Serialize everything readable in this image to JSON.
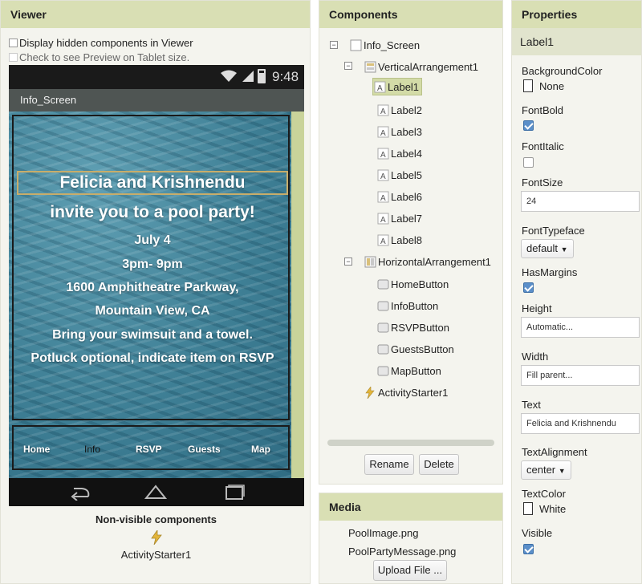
{
  "viewer": {
    "title": "Viewer",
    "display_hidden_label": "Display hidden components in Viewer",
    "tablet_preview_label": "Check to see Preview on Tablet size.",
    "status_time": "9:48",
    "screen_title": "Info_Screen",
    "message_lines": [
      "Felicia and Krishnendu",
      "invite you to a pool party!",
      "July 4",
      "3pm- 9pm",
      "1600 Amphitheatre Parkway,",
      "Mountain View, CA",
      "Bring your swimsuit and a towel.",
      "Potluck optional, indicate item on RSVP"
    ],
    "nav_buttons": [
      "Home",
      "Info",
      "RSVP",
      "Guests",
      "Map"
    ],
    "nonvisible_title": "Non-visible components",
    "nonvisible_item": "ActivityStarter1"
  },
  "components": {
    "title": "Components",
    "root": "Info_Screen",
    "vertical": "VerticalArrangement1",
    "labels": [
      "Label1",
      "Label2",
      "Label3",
      "Label4",
      "Label5",
      "Label6",
      "Label7",
      "Label8"
    ],
    "horizontal": "HorizontalArrangement1",
    "buttons": [
      "HomeButton",
      "InfoButton",
      "RSVPButton",
      "GuestsButton",
      "MapButton"
    ],
    "activity": "ActivityStarter1",
    "rename_label": "Rename",
    "delete_label": "Delete"
  },
  "media": {
    "title": "Media",
    "files": [
      "PoolImage.png",
      "PoolPartyMessage.png"
    ],
    "upload_label": "Upload File ..."
  },
  "properties": {
    "title": "Properties",
    "selected": "Label1",
    "background_color_label": "BackgroundColor",
    "background_color_value": "None",
    "fontbold_label": "FontBold",
    "fontbold_checked": true,
    "fontitalic_label": "FontItalic",
    "fontitalic_checked": false,
    "fontsize_label": "FontSize",
    "fontsize_value": "24",
    "fonttypeface_label": "FontTypeface",
    "fonttypeface_value": "default",
    "hasmargins_label": "HasMargins",
    "hasmargins_checked": true,
    "height_label": "Height",
    "height_value": "Automatic...",
    "width_label": "Width",
    "width_value": "Fill parent...",
    "text_label": "Text",
    "text_value": "Felicia and Krishnendu",
    "textalignment_label": "TextAlignment",
    "textalignment_value": "center",
    "textcolor_label": "TextColor",
    "textcolor_value": "White",
    "visible_label": "Visible",
    "visible_checked": true
  },
  "colors": {
    "panel_header": "#d9dfb4",
    "selection": "#d3dba7",
    "pool_water": "#3e7f95",
    "checkbox_on": "#5b8fc9"
  },
  "icons": [
    "wifi-icon",
    "signal-icon",
    "battery-icon",
    "back-nav-icon",
    "home-nav-icon",
    "recents-nav-icon",
    "screen-icon",
    "arrangement-icon",
    "label-icon",
    "button-icon",
    "activity-starter-icon",
    "dropdown-caret-icon"
  ]
}
